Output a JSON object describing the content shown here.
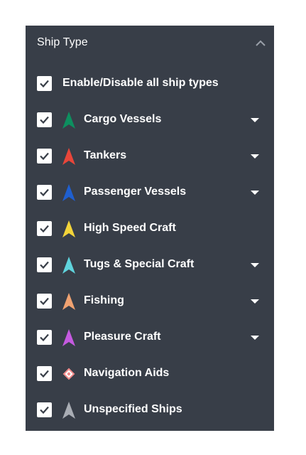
{
  "panel": {
    "title": "Ship Type",
    "collapse_icon": "chevron-up-icon",
    "colors": {
      "background": "#383e48",
      "text": "#ffffff",
      "checkbox": "#ffffff",
      "checkmark": "#383e48"
    }
  },
  "master_toggle": {
    "label": "Enable/Disable all ship types",
    "checked": true
  },
  "ship_types": [
    {
      "label": "Cargo Vessels",
      "checked": true,
      "color": "#0d8f5f",
      "icon": "arrow-icon",
      "has_dropdown": true
    },
    {
      "label": "Tankers",
      "checked": true,
      "color": "#e8463a",
      "icon": "arrow-icon",
      "has_dropdown": true
    },
    {
      "label": "Passenger Vessels",
      "checked": true,
      "color": "#1f5fcf",
      "icon": "arrow-icon",
      "has_dropdown": true
    },
    {
      "label": "High Speed Craft",
      "checked": true,
      "color": "#f2d43a",
      "icon": "arrow-icon",
      "has_dropdown": false
    },
    {
      "label": "Tugs & Special Craft",
      "checked": true,
      "color": "#5fd3dc",
      "icon": "arrow-icon",
      "has_dropdown": true
    },
    {
      "label": "Fishing",
      "checked": true,
      "color": "#f0a271",
      "icon": "arrow-icon",
      "has_dropdown": true
    },
    {
      "label": "Pleasure Craft",
      "checked": true,
      "color": "#c55ae0",
      "icon": "arrow-icon",
      "has_dropdown": true
    },
    {
      "label": "Navigation Aids",
      "checked": true,
      "color": "#f08a8a",
      "icon": "diamond-icon",
      "has_dropdown": false
    },
    {
      "label": "Unspecified Ships",
      "checked": true,
      "color": "#a9adb4",
      "icon": "arrow-icon",
      "has_dropdown": false
    }
  ]
}
